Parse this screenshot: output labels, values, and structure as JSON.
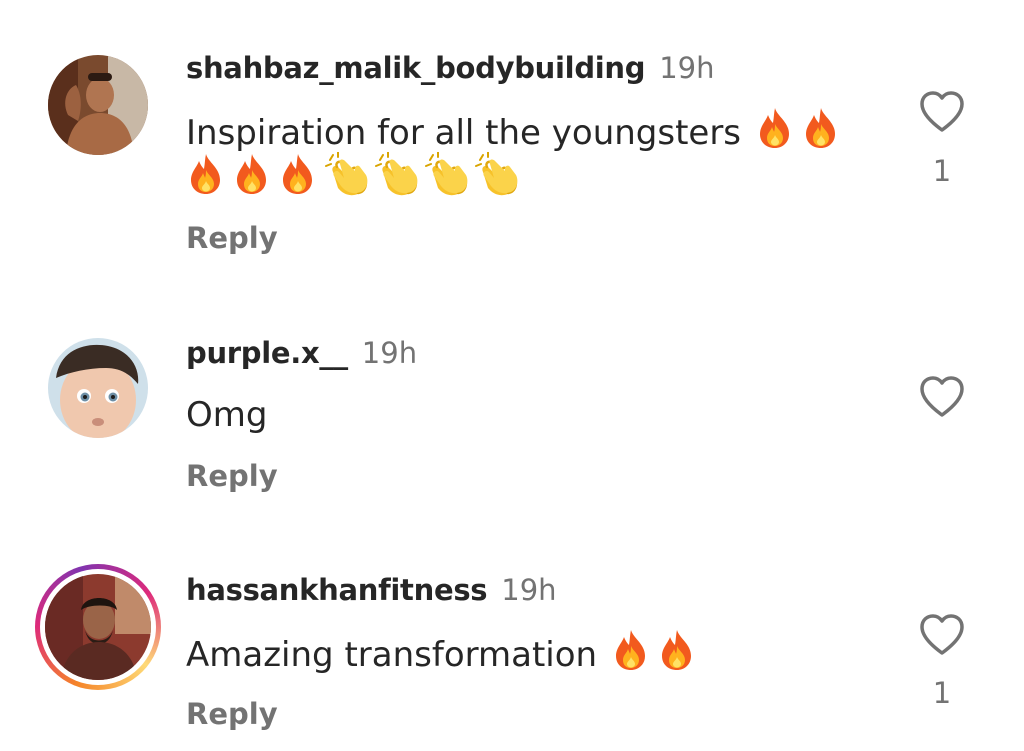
{
  "comments": [
    {
      "username": "shahbaz_malik_bodybuilding",
      "time": "19h",
      "text": "Inspiration for all the youngsters",
      "emoji_line1": [
        "fire",
        "fire"
      ],
      "emoji_line2": [
        "fire",
        "fire",
        "fire",
        "clap",
        "clap",
        "clap",
        "clap"
      ],
      "reply": "Reply",
      "likes": "1"
    },
    {
      "username": "purple.x__",
      "time": "19h",
      "text": "Omg",
      "reply": "Reply",
      "likes": ""
    },
    {
      "username": "hassankhanfitness",
      "time": "19h",
      "text": "Amazing transformation",
      "emoji_line1": [
        "fire",
        "fire"
      ],
      "reply": "Reply",
      "likes": "1",
      "has_story_ring": true
    }
  ],
  "icons": {
    "like": "heart-outline-icon",
    "fire": "fire-emoji-icon",
    "clap": "clapping-hands-emoji-icon"
  },
  "colors": {
    "username": "#262626",
    "secondary": "#737373",
    "story_ring_start": "#f58529",
    "story_ring_end": "#dd2a7b"
  }
}
